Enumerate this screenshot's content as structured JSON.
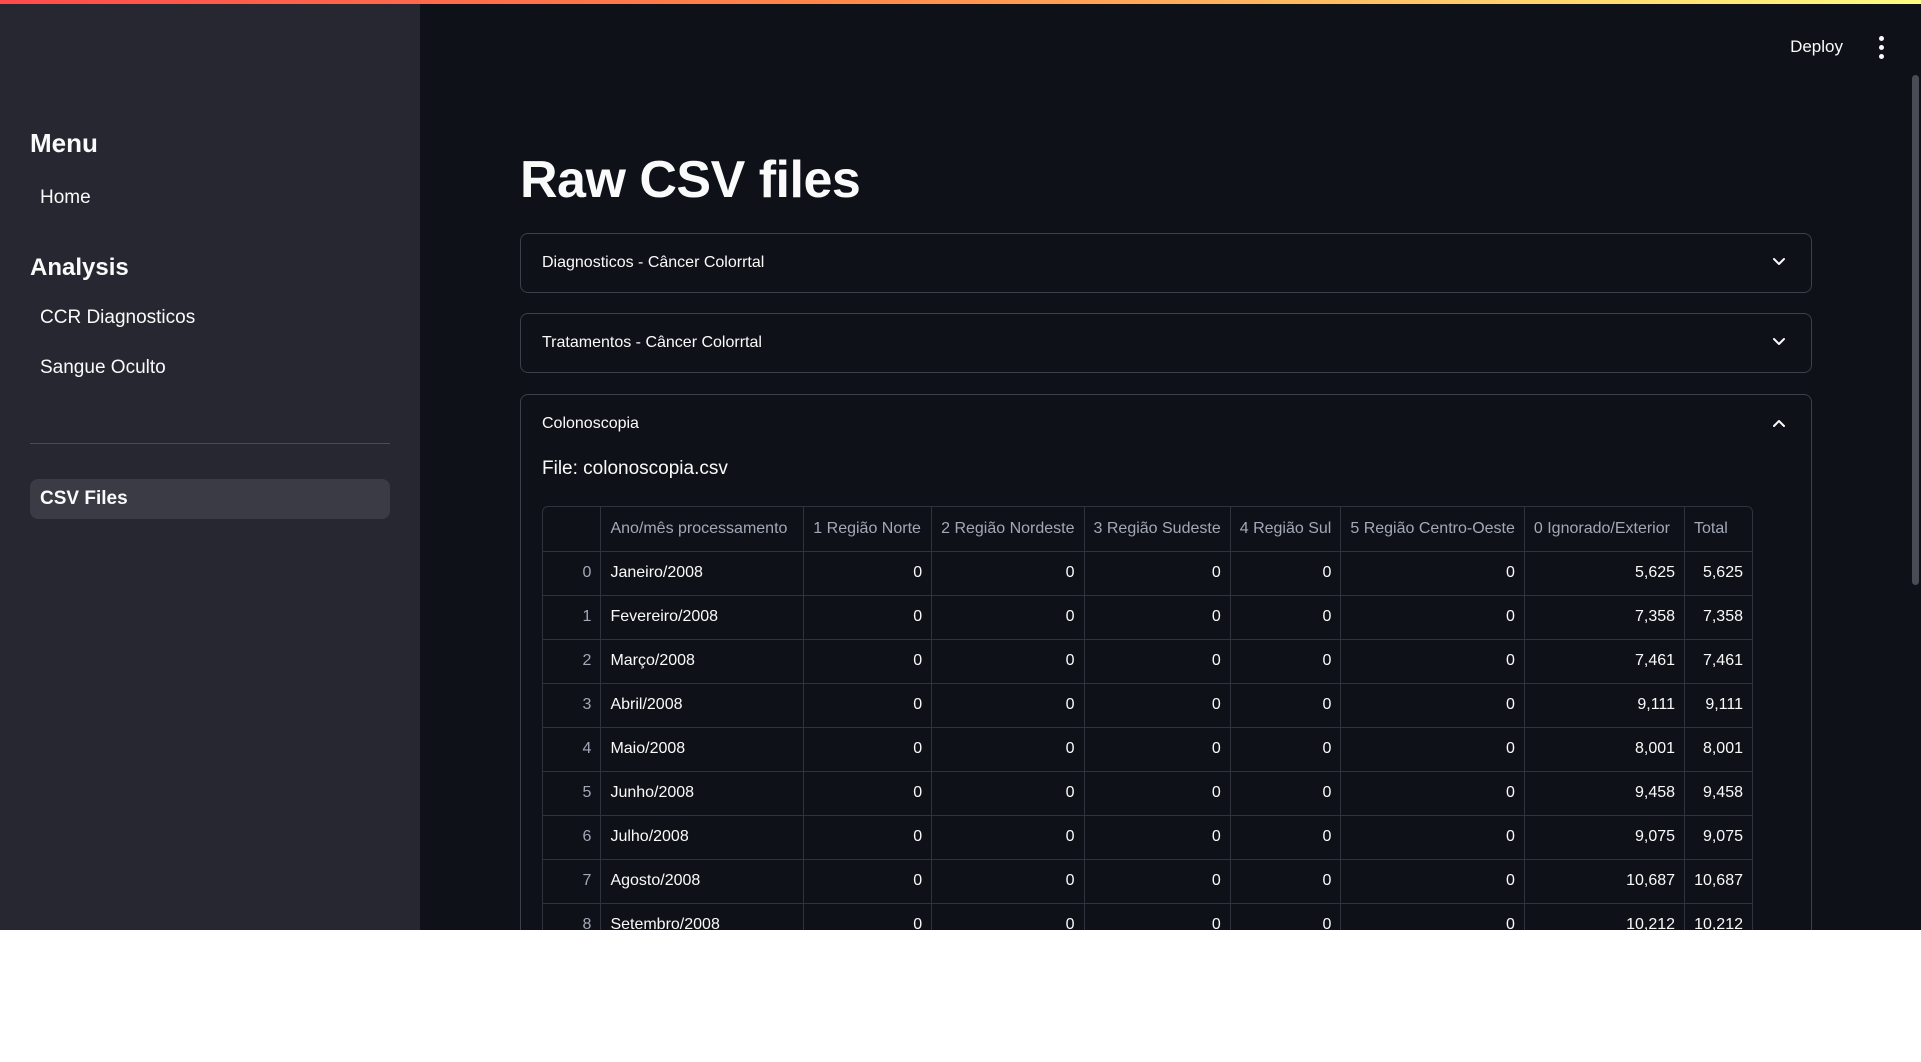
{
  "sidebar": {
    "menu_heading": "Menu",
    "home_label": "Home",
    "analysis_heading": "Analysis",
    "analysis_items": [
      {
        "label": "CCR Diagnosticos"
      },
      {
        "label": "Sangue Oculto"
      }
    ],
    "csv_files_label": "CSV Files"
  },
  "header": {
    "deploy_label": "Deploy",
    "more_icon": "vertical-ellipsis-icon"
  },
  "main": {
    "title": "Raw CSV files",
    "expanders": [
      {
        "label": "Diagnosticos - Câncer Colorrtal",
        "expanded": false,
        "icon": "chevron-down-icon"
      },
      {
        "label": "Tratamentos - Câncer Colorrtal",
        "expanded": false,
        "icon": "chevron-down-icon"
      },
      {
        "label": "Colonoscopia",
        "expanded": true,
        "icon": "chevron-up-icon"
      }
    ],
    "file_label": "File: colonoscopia.csv",
    "table": {
      "columns": [
        "",
        "Ano/mês processamento",
        "1 Região Norte",
        "2 Região Nordeste",
        "3 Região Sudeste",
        "4 Região Sul",
        "5 Região Centro-Oeste",
        "0 Ignorado/Exterior",
        "Total"
      ],
      "rows": [
        [
          "0",
          "Janeiro/2008",
          "0",
          "0",
          "0",
          "0",
          "0",
          "5,625",
          "5,625"
        ],
        [
          "1",
          "Fevereiro/2008",
          "0",
          "0",
          "0",
          "0",
          "0",
          "7,358",
          "7,358"
        ],
        [
          "2",
          "Março/2008",
          "0",
          "0",
          "0",
          "0",
          "0",
          "7,461",
          "7,461"
        ],
        [
          "3",
          "Abril/2008",
          "0",
          "0",
          "0",
          "0",
          "0",
          "9,111",
          "9,111"
        ],
        [
          "4",
          "Maio/2008",
          "0",
          "0",
          "0",
          "0",
          "0",
          "8,001",
          "8,001"
        ],
        [
          "5",
          "Junho/2008",
          "0",
          "0",
          "0",
          "0",
          "0",
          "9,458",
          "9,458"
        ],
        [
          "6",
          "Julho/2008",
          "0",
          "0",
          "0",
          "0",
          "0",
          "9,075",
          "9,075"
        ],
        [
          "7",
          "Agosto/2008",
          "0",
          "0",
          "0",
          "0",
          "0",
          "10,687",
          "10,687"
        ],
        [
          "8",
          "Setembro/2008",
          "0",
          "0",
          "0",
          "0",
          "0",
          "10,212",
          "10,212"
        ]
      ]
    }
  },
  "colors": {
    "background": "#0e1117",
    "sidebar": "#262730",
    "text": "#fafafa",
    "accent_gradient_start": "#ff4b4b",
    "accent_gradient_end": "#fffd80"
  }
}
